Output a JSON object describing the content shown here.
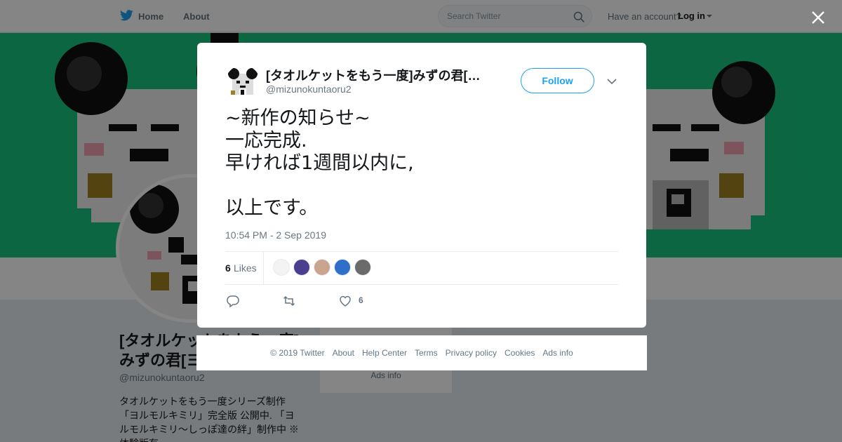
{
  "topbar": {
    "home_label": "Home",
    "about_label": "About",
    "search_placeholder": "Search Twitter",
    "have_account": "Have an account?",
    "login_label": "Log in"
  },
  "profile": {
    "name": "[タオルケットをもう一度]みずの君[ヨ…",
    "handle": "@mizunokuntaoru2",
    "bio": "タオルケットをもう一度シリーズ制作 「ヨルモルキミリ」完全版 公開中. 「ヨルモルキミリ～しっぽ達の絆」制作中 ※体験版有",
    "side_ads": "Ads info"
  },
  "tweet": {
    "author_name": "[タオルケットをもう一度]みずの君[…",
    "author_handle": "@mizunokuntaoru2",
    "follow_label": "Follow",
    "lines": [
      "~新作の知らせ~",
      "一応完成.",
      "早ければ1週間以内に,",
      "",
      "以上です。"
    ],
    "timestamp": "10:54 PM - 2 Sep 2019",
    "likes_count": "6",
    "likes_label": "Likes",
    "like_action_count": "6"
  },
  "likers": [
    {
      "color": "#f3f3f3"
    },
    {
      "color": "#4a3f8f"
    },
    {
      "color": "#c9a48f"
    },
    {
      "color": "#2f6fc7"
    },
    {
      "color": "#6b6b6b"
    }
  ],
  "footer": {
    "links": [
      "© 2019 Twitter",
      "About",
      "Help Center",
      "Terms",
      "Privacy policy",
      "Cookies",
      "Ads info"
    ]
  },
  "colors": {
    "banner": "#16c47e",
    "accent": "#1da1f2"
  },
  "icons": [
    "twitter-bird-icon",
    "search-icon",
    "close-icon",
    "chevron-down-icon",
    "reply-icon",
    "retweet-icon",
    "heart-icon"
  ]
}
